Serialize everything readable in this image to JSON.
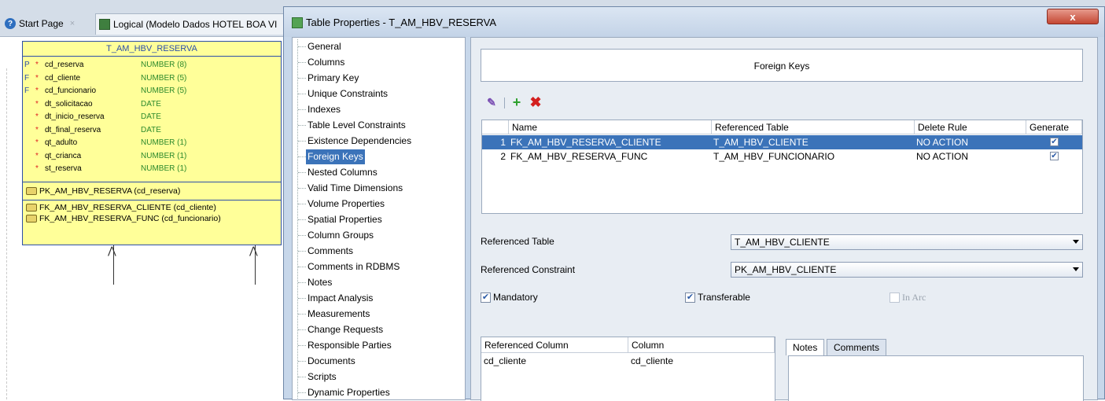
{
  "tabs": [
    {
      "label": "Start Page",
      "icon": "help-icon"
    },
    {
      "label": "Logical (Modelo Dados HOTEL BOA VI",
      "icon": "model-icon"
    }
  ],
  "entity": {
    "title": "T_AM_HBV_RESERVA",
    "columns": [
      {
        "flag": "P",
        "required": "*",
        "name": "cd_reserva",
        "type": "NUMBER (8)"
      },
      {
        "flag": "F",
        "required": "*",
        "name": "cd_cliente",
        "type": "NUMBER (5)"
      },
      {
        "flag": "F",
        "required": "*",
        "name": "cd_funcionario",
        "type": "NUMBER (5)"
      },
      {
        "flag": "",
        "required": "*",
        "name": "dt_solicitacao",
        "type": "DATE"
      },
      {
        "flag": "",
        "required": "*",
        "name": "dt_inicio_reserva",
        "type": "DATE"
      },
      {
        "flag": "",
        "required": "*",
        "name": "dt_final_reserva",
        "type": "DATE"
      },
      {
        "flag": "",
        "required": "*",
        "name": "qt_adulto",
        "type": "NUMBER (1)"
      },
      {
        "flag": "",
        "required": "*",
        "name": "qt_crianca",
        "type": "NUMBER (1)"
      },
      {
        "flag": "",
        "required": "*",
        "name": "st_reserva",
        "type": "NUMBER (1)"
      }
    ],
    "pk": "PK_AM_HBV_RESERVA (cd_reserva)",
    "fks": [
      "FK_AM_HBV_RESERVA_CLIENTE (cd_cliente)",
      "FK_AM_HBV_RESERVA_FUNC (cd_funcionario)"
    ]
  },
  "dialog": {
    "title": "Table Properties - T_AM_HBV_RESERVA",
    "close": "x",
    "nav": [
      "General",
      "Columns",
      "Primary Key",
      "Unique Constraints",
      "Indexes",
      "Table Level Constraints",
      "Existence Dependencies",
      "Foreign Keys",
      "Nested Columns",
      "Valid Time Dimensions",
      "Volume Properties",
      "Spatial Properties",
      "Column Groups",
      "Comments",
      "Comments in RDBMS",
      "Notes",
      "Impact Analysis",
      "Measurements",
      "Change Requests",
      "Responsible Parties",
      "Documents",
      "Scripts",
      "Dynamic Properties"
    ],
    "nav_selected": "Foreign Keys",
    "section_title": "Foreign Keys",
    "grid": {
      "headers": [
        "Name",
        "Referenced Table",
        "Delete Rule",
        "Generate"
      ],
      "rows": [
        {
          "num": "1",
          "name": "FK_AM_HBV_RESERVA_CLIENTE",
          "ref_table": "T_AM_HBV_CLIENTE",
          "delete_rule": "NO ACTION",
          "generate": true
        },
        {
          "num": "2",
          "name": "FK_AM_HBV_RESERVA_FUNC",
          "ref_table": "T_AM_HBV_FUNCIONARIO",
          "delete_rule": "NO ACTION",
          "generate": true
        }
      ]
    },
    "referenced_table_label": "Referenced Table",
    "referenced_table_value": "T_AM_HBV_CLIENTE",
    "referenced_constraint_label": "Referenced Constraint",
    "referenced_constraint_value": "PK_AM_HBV_CLIENTE",
    "mandatory_label": "Mandatory",
    "transferable_label": "Transferable",
    "in_arc_label": "In Arc",
    "colgrid": {
      "headers": [
        "Referenced Column",
        "Column"
      ],
      "rows": [
        {
          "ref": "cd_cliente",
          "col": "cd_cliente"
        }
      ]
    },
    "notes_tabs": [
      "Notes",
      "Comments"
    ]
  },
  "colors": {
    "selection": "#3b73b9",
    "entity_fill": "#ffff99",
    "entity_border": "#2d4fa8"
  }
}
